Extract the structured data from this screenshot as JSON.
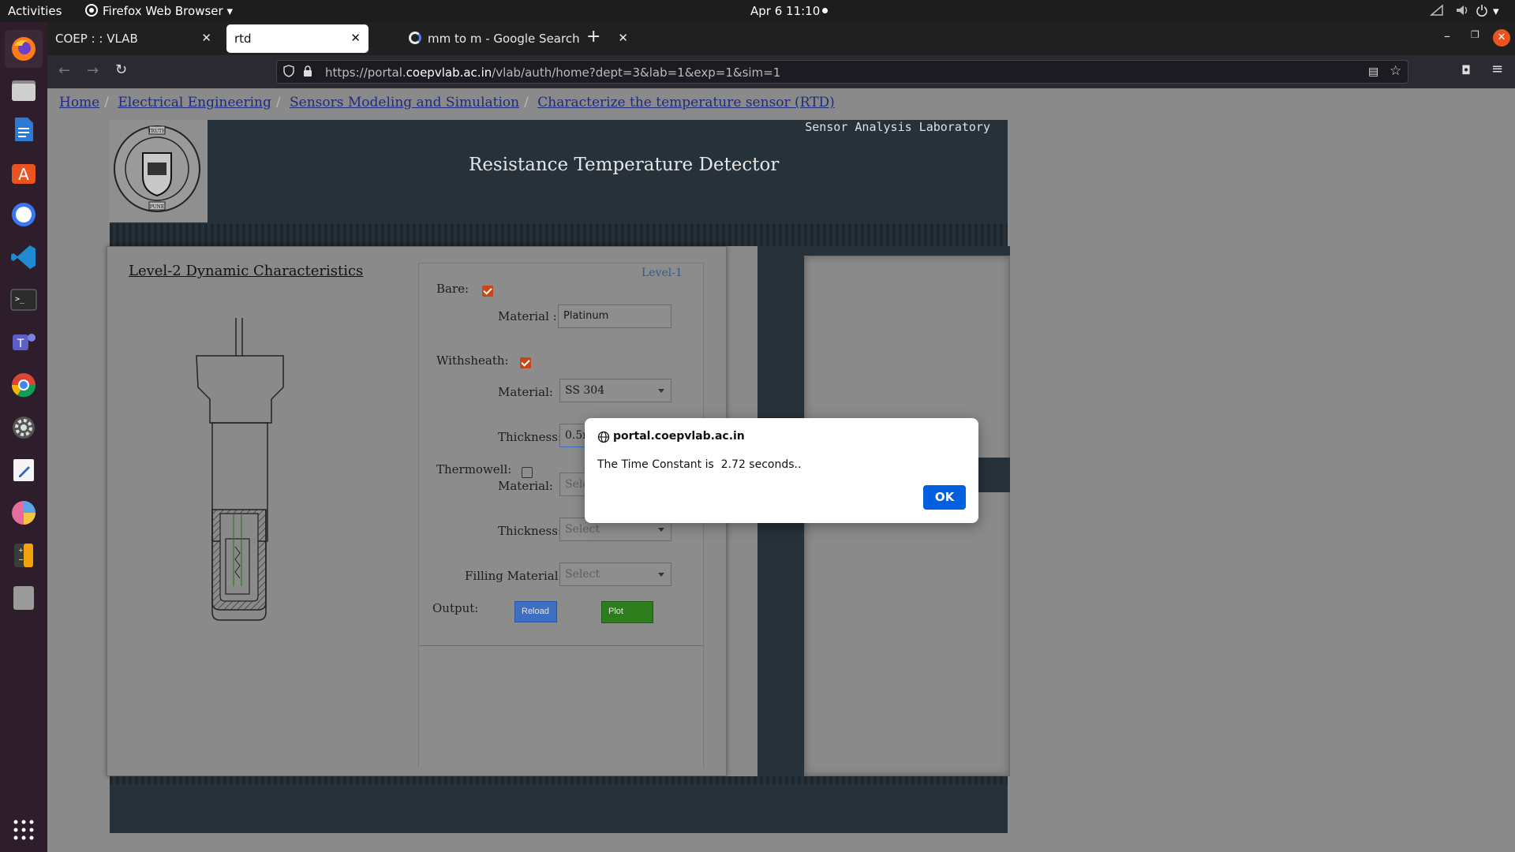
{
  "system_bar": {
    "activities": "Activities",
    "app_name": "Firefox Web Browser",
    "clock": "Apr 6  11:10"
  },
  "browser": {
    "tabs": [
      {
        "label": "COEP : : VLAB",
        "active": false
      },
      {
        "label": "rtd",
        "active": true
      },
      {
        "label": "mm to m - Google Search",
        "active": false
      }
    ],
    "url_prefix": "https://portal.",
    "url_domain": "coepvlab.ac.in",
    "url_path": "/vlab/auth/home?dept=3&lab=1&exp=1&sim=1"
  },
  "breadcrumb": {
    "items": [
      "Home",
      "Electrical Engineering",
      "Sensors Modeling and Simulation",
      "Characterize the temperature sensor (RTD)"
    ]
  },
  "header": {
    "lab_name": "Sensor Analysis Laboratory",
    "title": "Resistance Temperature Detector",
    "logo_text": [
      "TRUTH",
      "STRENGTH",
      "EXCELLENCE",
      "COLLEGE OF ENGINEERING",
      "PUNE"
    ]
  },
  "sim": {
    "heading": "Level-2 Dynamic Characteristics",
    "level_link": "Level-1",
    "bare_label": "Bare:",
    "bare_checked": true,
    "bare_material_label": "Material :",
    "bare_material_value": "Platinum",
    "withsheath_label": "Withsheath:",
    "withsheath_checked": true,
    "sheath_material_label": "Material:",
    "sheath_material_value": "SS 304",
    "sheath_thickness_label": "Thickness:",
    "sheath_thickness_value": "0.5n",
    "thermowell_label": "Thermowell:",
    "thermowell_checked": false,
    "thermowell_material_label": "Material:",
    "thermowell_material_value": "Sele",
    "thermowell_thickness_label": "Thickness:",
    "thermowell_thickness_value": "Select",
    "filling_label": "Filling Material:",
    "filling_value": "Select",
    "output_label": "Output:",
    "reload_label": "Reload",
    "plot_label": "Plot"
  },
  "dialog": {
    "origin": "portal.coepvlab.ac.in",
    "message": "The Time Constant is  2.72 seconds..",
    "ok_label": "OK"
  },
  "colors": {
    "accent_blue": "#0060df",
    "header_dark": "#26313a",
    "checkbox_orange": "#c7471a",
    "reload_blue": "#3f6fc4",
    "plot_green": "#2e7d1c"
  }
}
